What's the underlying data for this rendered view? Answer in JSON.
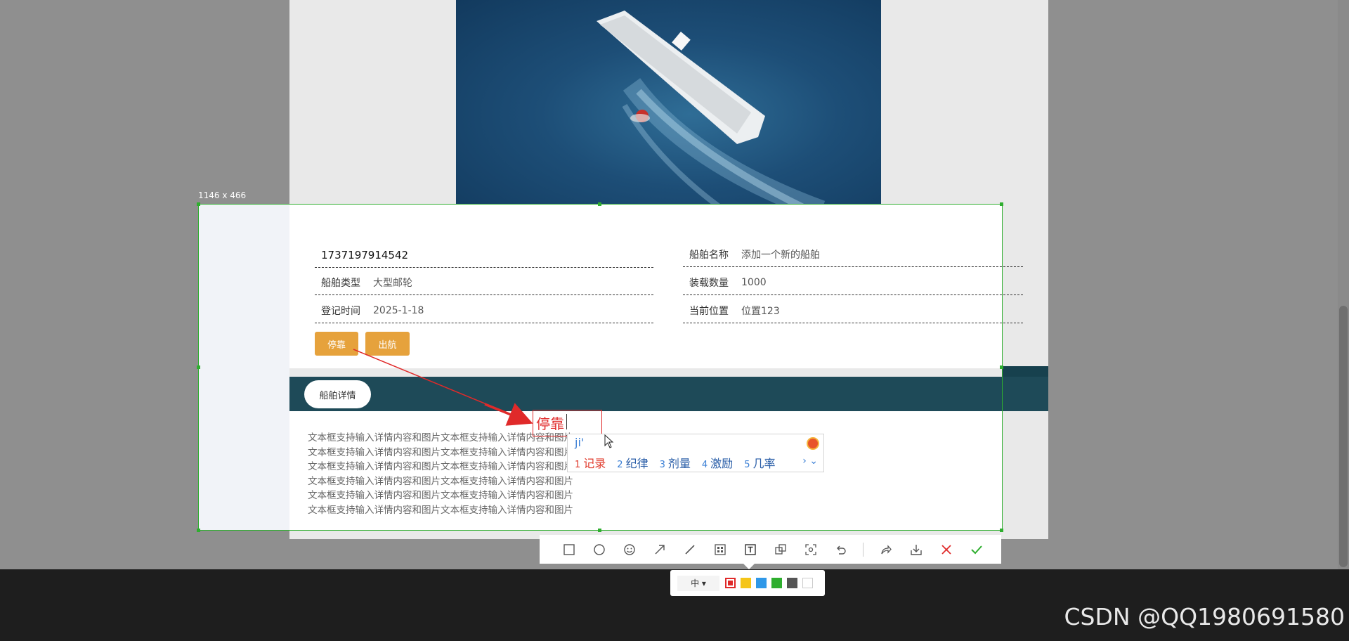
{
  "screenshot_tool": {
    "size_label": "1146 x 466",
    "tools": [
      {
        "icon": "rectangle-icon"
      },
      {
        "icon": "circle-icon"
      },
      {
        "icon": "emoji-icon"
      },
      {
        "icon": "arrow-icon"
      },
      {
        "icon": "line-icon"
      },
      {
        "icon": "mosaic-icon"
      },
      {
        "icon": "text-icon"
      },
      {
        "icon": "pin-icon"
      },
      {
        "icon": "ocr-icon"
      },
      {
        "icon": "undo-icon"
      },
      {
        "icon": "share-icon"
      },
      {
        "icon": "download-icon"
      },
      {
        "icon": "close-icon"
      },
      {
        "icon": "confirm-icon"
      }
    ],
    "font_size": "中 ▾",
    "colors": [
      "#e02a2a",
      "#f5c518",
      "#2f98e8",
      "#2fae2f",
      "#555555",
      "#ffffff"
    ],
    "selected_color": "#e02a2a"
  },
  "annotation": {
    "text": "停靠"
  },
  "ime": {
    "input": "ji'",
    "candidates": [
      {
        "num": "1",
        "text": "记录"
      },
      {
        "num": "2",
        "text": "纪律"
      },
      {
        "num": "3",
        "text": "剂量"
      },
      {
        "num": "4",
        "text": "激励"
      },
      {
        "num": "5",
        "text": "几率"
      }
    ],
    "more": "› ⌄"
  },
  "ship": {
    "id": "1737197914542",
    "fields": {
      "name_label": "船舶名称",
      "name_value": "添加一个新的船舶",
      "type_label": "船舶类型",
      "type_value": "大型邮轮",
      "capacity_label": "装载数量",
      "capacity_value": "1000",
      "date_label": "登记时间",
      "date_value": "2025-1-18",
      "location_label": "当前位置",
      "location_value": "位置123"
    },
    "buttons": {
      "dock": "停靠",
      "sail": "出航"
    }
  },
  "details": {
    "tab": "船舶详情",
    "lines": [
      "文本框支持输入详情内容和图片文本框支持输入详情内容和图片",
      "文本框支持输入详情内容和图片文本框支持输入详情内容和图片",
      "文本框支持输入详情内容和图片文本框支持输入详情内容和图片",
      "文本框支持输入详情内容和图片文本框支持输入详情内容和图片",
      "文本框支持输入详情内容和图片文本框支持输入详情内容和图片",
      "文本框支持输入详情内容和图片文本框支持输入详情内容和图片"
    ]
  },
  "watermark": "CSDN @QQ1980691580"
}
